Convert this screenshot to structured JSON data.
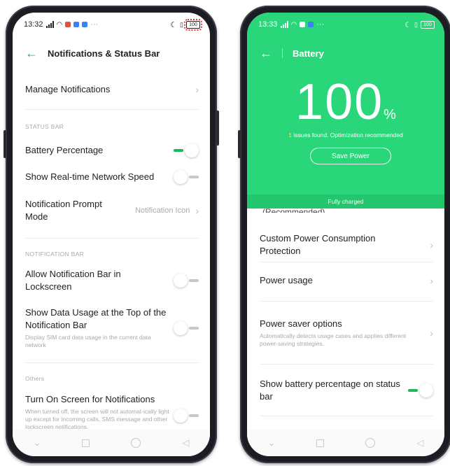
{
  "left_phone": {
    "status": {
      "time": "13:32",
      "battery": "100"
    },
    "header": {
      "title": "Notifications & Status Bar"
    },
    "manage_notifications": "Manage Notifications",
    "section_status_bar": "STATUS BAR",
    "battery_percentage": {
      "label": "Battery Percentage",
      "enabled": true
    },
    "network_speed": {
      "label": "Show Real-time Network Speed",
      "enabled": false
    },
    "prompt_mode": {
      "label": "Notification Prompt Mode",
      "value": "Notification Icon"
    },
    "section_notification_bar": "NOTIFICATION BAR",
    "allow_lockscreen": {
      "label": "Allow Notification Bar in Lockscreen",
      "enabled": false
    },
    "data_usage": {
      "label": "Show Data Usage at the Top of the Notification Bar",
      "description": "Display SIM card data usage in the current data network",
      "enabled": false
    },
    "section_others": "Others",
    "turn_on_screen": {
      "label": "Turn On Screen for Notifications",
      "description": "When turned off, the screen will not automat-ically light up except for incoming calls, SMS message and other lockscreen notifications.",
      "enabled": false
    }
  },
  "right_phone": {
    "status": {
      "time": "13:33",
      "battery": "100"
    },
    "header": {
      "title": "Battery"
    },
    "percent_value": "100",
    "percent_unit": "%",
    "issues_count": "1",
    "issues_text": "issues found. Optimization recommended",
    "save_power": "Save Power",
    "fully_charged": "Fully charged",
    "cut_text": "(Recommended)",
    "custom_power": "Custom Power Consumption Protection",
    "power_usage": "Power usage",
    "power_saver": {
      "label": "Power saver options",
      "description": "Automatically detects usage cases and applies different power-saving strategies."
    },
    "show_percentage": {
      "label": "Show battery percentage on status bar",
      "enabled": true
    }
  },
  "colors": {
    "accent_green": "#2ad67a",
    "toggle_on": "#1db954",
    "highlight": "#e53935"
  }
}
